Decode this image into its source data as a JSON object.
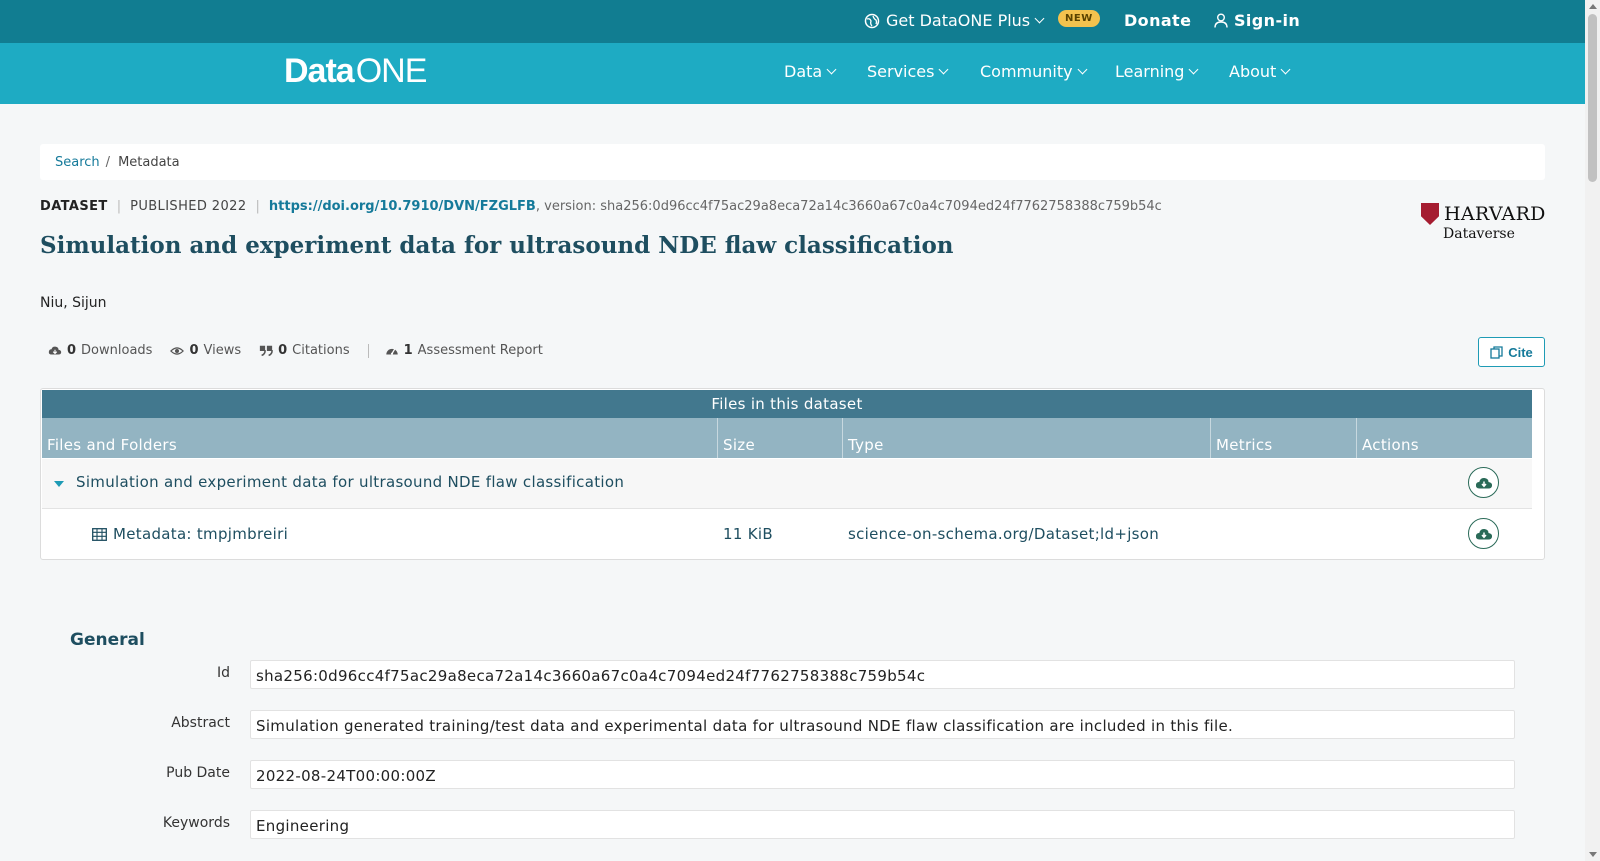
{
  "topbar": {
    "plus_label": "Get DataONE Plus",
    "new_badge": "NEW",
    "donate": "Donate",
    "signin": "Sign-in"
  },
  "logo": {
    "data": "Data",
    "one": "ONE"
  },
  "nav": [
    "Data",
    "Services",
    "Community",
    "Learning",
    "About"
  ],
  "breadcrumb": {
    "search": "Search",
    "sep": "/",
    "current": "Metadata"
  },
  "dataset": {
    "type": "DATASET",
    "published": "PUBLISHED 2022",
    "doi": "https://doi.org/10.7910/DVN/FZGLFB",
    "doi_suffix": ",",
    "version": "version: sha256:0d96cc4f75ac29a8eca72a14c3660a67c0a4c7094ed24f7762758388c759b54c",
    "title": "Simulation and experiment data for ultrasound NDE flaw classification",
    "author": "Niu, Sijun"
  },
  "repository": {
    "name": "HARVARD",
    "sub": "Dataverse"
  },
  "metrics": {
    "downloads_count": "0",
    "downloads_label": "Downloads",
    "views_count": "0",
    "views_label": "Views",
    "citations_count": "0",
    "citations_label": "Citations",
    "assessment_count": "1",
    "assessment_label": "Assessment Report"
  },
  "cite_label": "Cite",
  "files": {
    "header": "Files in this dataset",
    "columns": [
      "Files and Folders",
      "Size",
      "Type",
      "Metrics",
      "Actions"
    ],
    "folder": "Simulation and experiment data for ultrasound NDE flaw classification",
    "items": [
      {
        "name": "Metadata: tmpjmbreiri",
        "size": "11 KiB",
        "type": "science-on-schema.org/Dataset;ld+json"
      }
    ]
  },
  "general": {
    "title": "General",
    "fields": [
      {
        "label": "Id",
        "value": "sha256:0d96cc4f75ac29a8eca72a14c3660a67c0a4c7094ed24f7762758388c759b54c"
      },
      {
        "label": "Abstract",
        "value": "Simulation generated training/test data and experimental data for ultrasound NDE flaw classification are included in this file."
      },
      {
        "label": "Pub Date",
        "value": "2022-08-24T00:00:00Z"
      },
      {
        "label": "Keywords",
        "value": "Engineering"
      }
    ]
  },
  "colors": {
    "topbar": "#117d91",
    "nav": "#1eabc3",
    "table_header": "#42788e",
    "table_columns": "#93b4c2",
    "title": "#1e4e60",
    "link": "#157a9a"
  }
}
